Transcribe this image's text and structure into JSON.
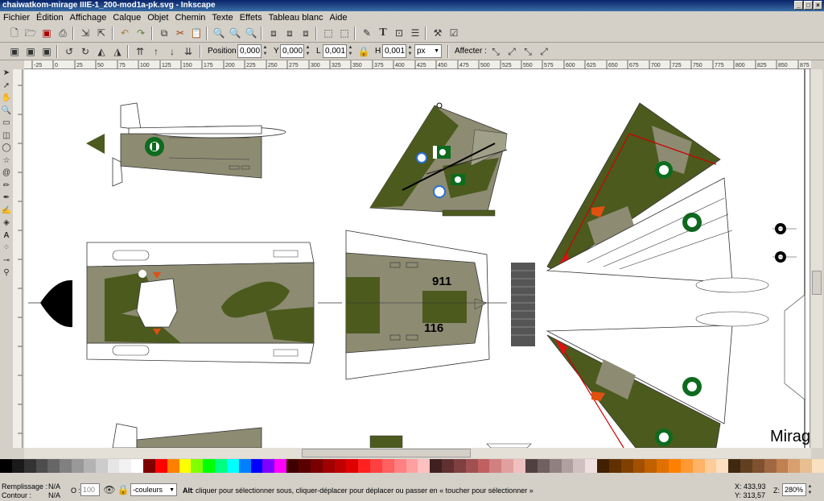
{
  "window": {
    "title": "chaiwatkom-mirage IIIE-1_200-mod1a-pk.svg - Inkscape"
  },
  "menu": [
    "Fichier",
    "Édition",
    "Affichage",
    "Calque",
    "Objet",
    "Chemin",
    "Texte",
    "Effets",
    "Tableau blanc",
    "Aide"
  ],
  "toolbar2": {
    "position_x_label": "Position X",
    "x_value": "0,000",
    "y_label": "Y",
    "y_value": "0,000",
    "l_label": "L",
    "l_value": "0,001",
    "h_label": "H",
    "h_value": "0,001",
    "unit": "px",
    "affecter_label": "Affecter :"
  },
  "ruler_labels": [
    "-25",
    "0",
    "25",
    "50",
    "75",
    "100",
    "125",
    "150",
    "175",
    "200",
    "225",
    "250",
    "275",
    "300",
    "325",
    "350",
    "375",
    "400",
    "425",
    "450",
    "475",
    "500",
    "525",
    "550",
    "575",
    "600",
    "625",
    "650",
    "675",
    "700",
    "725",
    "750",
    "775",
    "800",
    "825",
    "850",
    "875"
  ],
  "canvas": {
    "tail_number_1": "911",
    "tail_number_2": "116",
    "mirage_text": "Mirag"
  },
  "status": {
    "fill_label": "Remplissage :",
    "fill_value": "N/A",
    "stroke_label": "Contour :",
    "stroke_value": "N/A",
    "opacity_label": "O :",
    "opacity_value": "100",
    "layer": "-couleurs",
    "message_bold": "Alt",
    "message": " : cliquer pour sélectionner sous, cliquer-déplacer pour déplacer ou passer en « toucher pour sélectionner »",
    "x_coord": "X: 433,93",
    "y_coord": "Y: 313,57",
    "zoom_label": "Z:",
    "zoom_value": "280%"
  },
  "colors": {
    "olive": "#4c5a1e",
    "khaki": "#8d8b72",
    "green_roundel": "#0d6b1e",
    "palette": [
      "#000000",
      "#1a1a1a",
      "#333333",
      "#4d4d4d",
      "#666666",
      "#808080",
      "#999999",
      "#b3b3b3",
      "#cccccc",
      "#e6e6e6",
      "#f2f2f2",
      "#ffffff",
      "#800000",
      "#ff0000",
      "#ff8000",
      "#ffff00",
      "#80ff00",
      "#00ff00",
      "#00ff80",
      "#00ffff",
      "#0080ff",
      "#0000ff",
      "#8000ff",
      "#ff00ff",
      "#400000",
      "#5a0000",
      "#7a0000",
      "#a00000",
      "#c00000",
      "#e00000",
      "#ff2020",
      "#ff4040",
      "#ff6060",
      "#ff8080",
      "#ffa0a0",
      "#ffc0c0",
      "#402020",
      "#603030",
      "#804040",
      "#a05050",
      "#c06060",
      "#d08080",
      "#e0a0a0",
      "#f0c0c0",
      "#504040",
      "#706060",
      "#908080",
      "#b0a0a0",
      "#d0c0c0",
      "#f0e0e0",
      "#402000",
      "#603000",
      "#804000",
      "#a05000",
      "#c06000",
      "#e07000",
      "#ff8000",
      "#ff9933",
      "#ffb366",
      "#ffcc99",
      "#ffe0c0",
      "#402810",
      "#604020",
      "#805030",
      "#a06840",
      "#c08050",
      "#d8a070",
      "#e8c090",
      "#f8e0c0"
    ]
  }
}
